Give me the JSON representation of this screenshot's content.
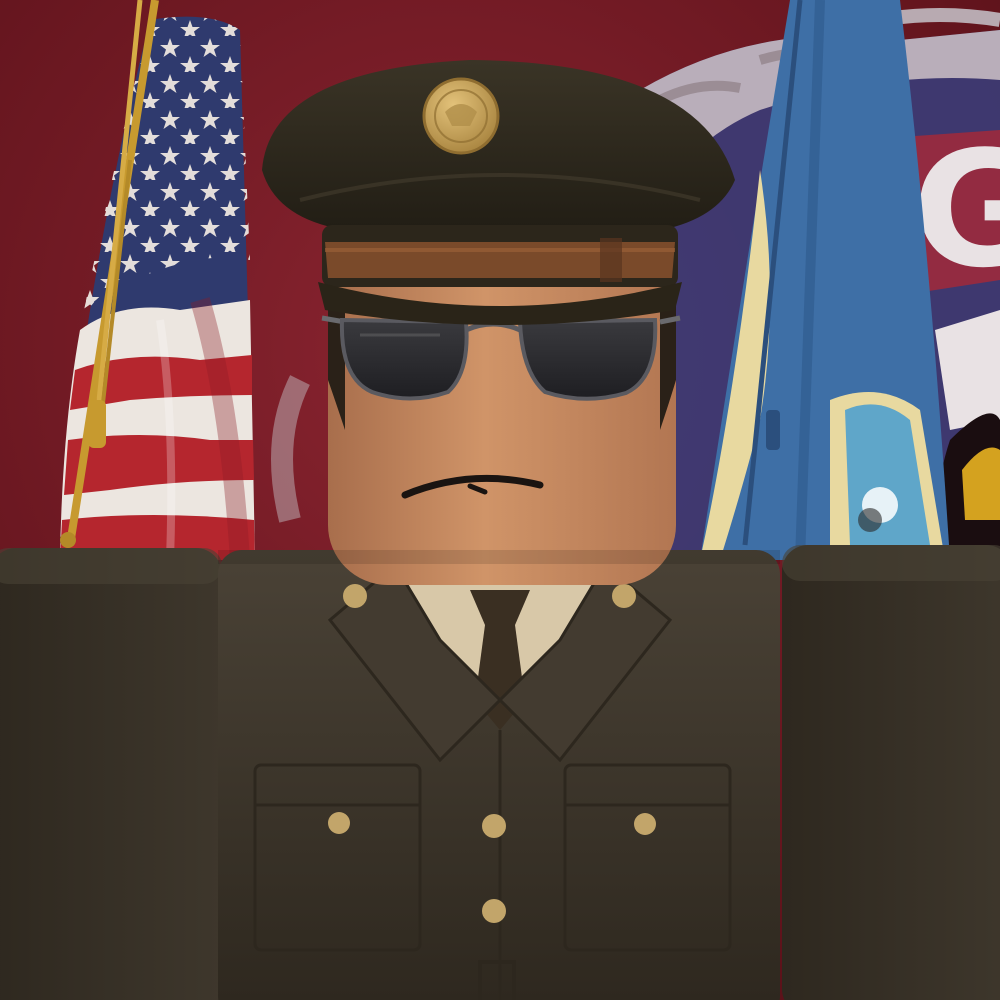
{
  "scene": {
    "emblem_text": "G",
    "colors": {
      "backdrop": "#7a1d28",
      "backdrop_dark": "#5a1119",
      "uniform": "#3b342a",
      "uniform_dark": "#2a241c",
      "uniform_light": "#4a4236",
      "cap_crown": "#2f2a1e",
      "cap_band": "#7a4a2a",
      "cap_badge": "#c9a45c",
      "skin": "#c98a62",
      "skin_shadow": "#a86e4c",
      "shirt": "#d8c8a8",
      "tie": "#3a2f22",
      "sunglasses": "#2b2b2e",
      "button": "#c2a56a",
      "flag_red": "#b5262e",
      "flag_white": "#ece6e0",
      "flag_blue": "#2f3a6e",
      "pole_gold": "#c79a2f",
      "state_flag_blue": "#3e6fa6",
      "state_flag_cream": "#e8d9a0"
    }
  }
}
